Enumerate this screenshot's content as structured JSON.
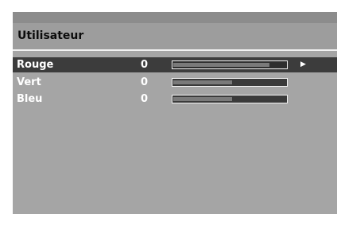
{
  "menu": {
    "title": "Utilisateur",
    "settings": [
      {
        "label": "Rouge",
        "value": "0",
        "level": 0.85,
        "selected": true
      },
      {
        "label": "Vert",
        "value": "0",
        "level": 0.52,
        "selected": false
      },
      {
        "label": "Bleu",
        "value": "0",
        "level": 0.52,
        "selected": false
      }
    ],
    "selection_arrow_icon": "right-triangle-icon"
  },
  "colors": {
    "panel": "#a5a5a5",
    "header": "#9d9d9d",
    "selected_row": "#3c3c3c",
    "text": "#ffffff",
    "title_text": "#0c0c0c"
  }
}
